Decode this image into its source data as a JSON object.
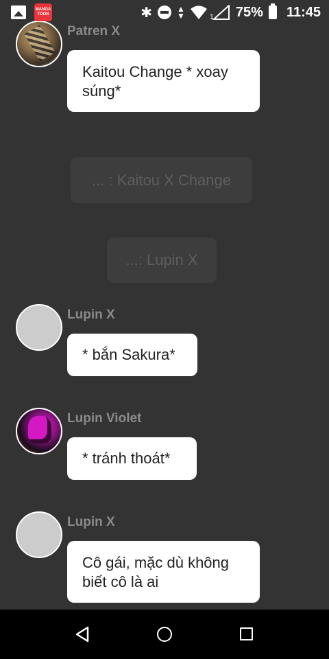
{
  "status_bar": {
    "app_icon_text": "MANGA TOON",
    "battery": "75%",
    "time": "11:45",
    "signal_sub": "1"
  },
  "messages": [
    {
      "sender": "Patren X",
      "text": "Kaitou Change * xoay súng*"
    },
    {
      "narration": "... : Kaitou X Change"
    },
    {
      "narration": "...: Lupin X"
    },
    {
      "sender": "Lupin X",
      "text": "* bắn Sakura*"
    },
    {
      "sender": "Lupin Violet",
      "text": "* tránh thoát*"
    },
    {
      "sender": "Lupin X",
      "text": "Cô gái, mặc dù không biết cô là ai"
    }
  ],
  "navigation": {
    "back": "back-icon",
    "home": "home-icon",
    "recents": "recents-icon"
  }
}
